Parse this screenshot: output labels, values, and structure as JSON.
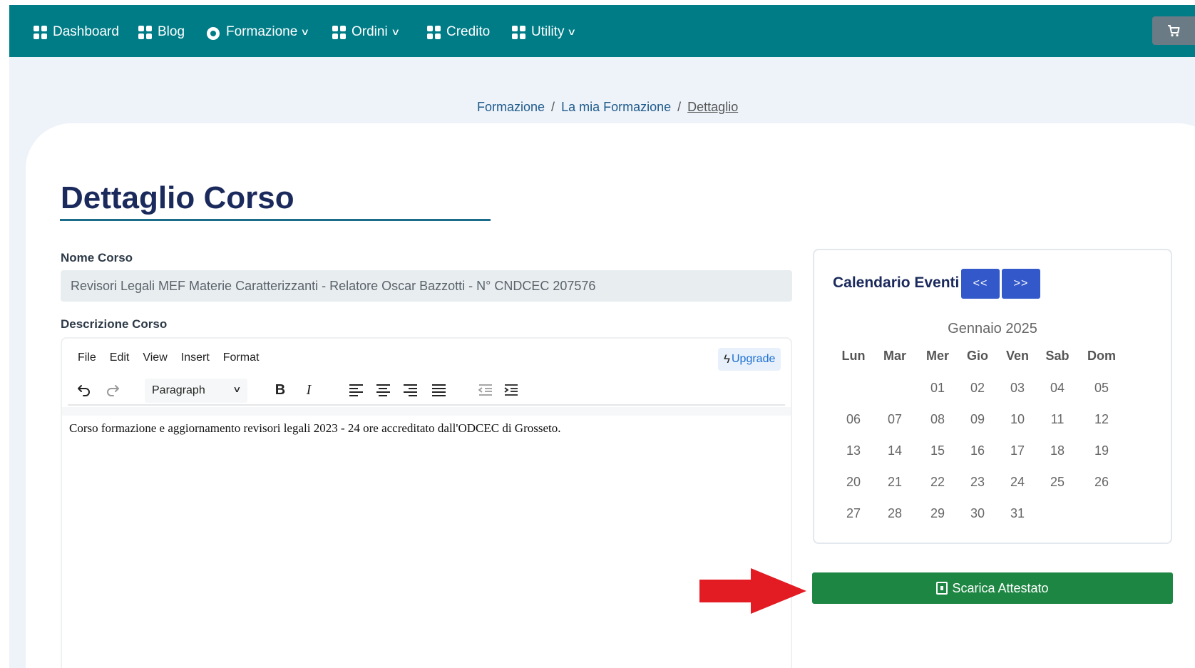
{
  "nav": {
    "items": [
      {
        "label": "Dashboard",
        "icon": "grid-icon",
        "dropdown": false
      },
      {
        "label": "Blog",
        "icon": "grid-icon",
        "dropdown": false
      },
      {
        "label": "Formazione",
        "icon": "globe-icon",
        "dropdown": true
      },
      {
        "label": "Ordini",
        "icon": "grid-icon",
        "dropdown": true
      },
      {
        "label": "Credito",
        "icon": "grid-icon",
        "dropdown": false
      },
      {
        "label": "Utility",
        "icon": "grid-icon",
        "dropdown": true
      }
    ],
    "cart_icon": "cart-icon",
    "bg_color": "#007c87"
  },
  "breadcrumb": {
    "items": [
      "Formazione",
      "La mia Formazione",
      "Dettaglio"
    ],
    "separator": "/"
  },
  "page": {
    "title": "Dettaglio Corso"
  },
  "course": {
    "name_label": "Nome Corso",
    "name_value": "Revisori Legali MEF Materie Caratterizzanti - Relatore Oscar Bazzotti - N° CNDCEC 207576",
    "description_label": "Descrizione Corso"
  },
  "editor": {
    "menu": [
      "File",
      "Edit",
      "View",
      "Insert",
      "Format"
    ],
    "upgrade_label": "Upgrade",
    "block_format": "Paragraph",
    "content": "Corso formazione e aggiornamento revisori legali 2023 - 24 ore accreditato dall'ODCEC di Grosseto."
  },
  "calendar": {
    "title": "Calendario Eventi",
    "prev_label": "<<",
    "next_label": ">>",
    "month": "Gennaio 2025",
    "weekdays": [
      "Lun",
      "Mar",
      "Mer",
      "Gio",
      "Ven",
      "Sab",
      "Dom"
    ],
    "weeks": [
      [
        "",
        "",
        "01",
        "02",
        "03",
        "04",
        "05"
      ],
      [
        "06",
        "07",
        "08",
        "09",
        "10",
        "11",
        "12"
      ],
      [
        "13",
        "14",
        "15",
        "16",
        "17",
        "18",
        "19"
      ],
      [
        "20",
        "21",
        "22",
        "23",
        "24",
        "25",
        "26"
      ],
      [
        "27",
        "28",
        "29",
        "30",
        "31",
        "",
        ""
      ]
    ]
  },
  "download": {
    "label": "Scarica Attestato",
    "color": "#1e8643"
  }
}
